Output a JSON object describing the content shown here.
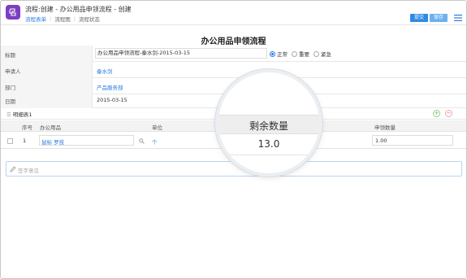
{
  "header": {
    "title": "流程:创建 - 办公用品申领流程 - 创建",
    "tabs": [
      "流程表单",
      "流程图",
      "流程状态"
    ],
    "submit_label": "提交",
    "save_label": "保存"
  },
  "form": {
    "title": "办公用品申领流程",
    "fields": {
      "title_label": "标题",
      "title_value": "办公用品申领流程-秦水剑-2015-03-15",
      "applicant_label": "申请人",
      "applicant_value": "秦水剑",
      "department_label": "部门",
      "department_value": "产品服务部",
      "date_label": "日期",
      "date_value": "2015-03-15"
    },
    "priority": {
      "options": [
        "正常",
        "重要",
        "紧急"
      ],
      "selected": "正常"
    }
  },
  "detail_table": {
    "title": "明细表1",
    "columns": {
      "seq": "序号",
      "item": "办公用品",
      "unit": "单位",
      "remaining": "剩余数量",
      "requested": "申领数量"
    },
    "rows": [
      {
        "seq": "1",
        "item": "鼠标 罗技",
        "unit": "个",
        "remaining": "13.0",
        "requested": "1.00"
      }
    ]
  },
  "signature": {
    "placeholder": "签字意见"
  },
  "colors": {
    "accent": "#2e8ae6",
    "logo": "#7d3ec2",
    "link": "#2a7ae2"
  }
}
